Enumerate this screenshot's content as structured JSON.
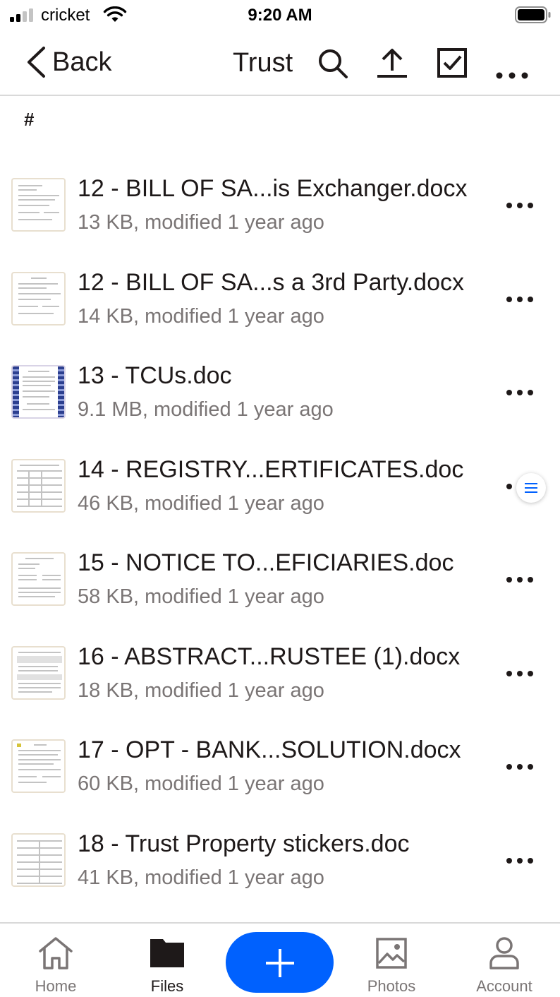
{
  "status_bar": {
    "carrier": "cricket",
    "time": "9:20 AM"
  },
  "nav": {
    "back_label": "Back",
    "title": "Trust"
  },
  "section_header": "#",
  "files": [
    {
      "name": "12 - BILL OF SA...is Exchanger.docx",
      "meta": "13 KB, modified 1 year ago",
      "thumb": "doc"
    },
    {
      "name": "12 - BILL OF SA...s a 3rd Party.docx",
      "meta": "14 KB, modified 1 year ago",
      "thumb": "doc"
    },
    {
      "name": "13 - TCUs.doc",
      "meta": "9.1 MB, modified 1 year ago",
      "thumb": "certificate"
    },
    {
      "name": "14 - REGISTRY...ERTIFICATES.doc",
      "meta": "46 KB, modified 1 year ago",
      "thumb": "table"
    },
    {
      "name": "15 - NOTICE TO...EFICIARIES.doc",
      "meta": "58 KB, modified 1 year ago",
      "thumb": "doc"
    },
    {
      "name": "16 - ABSTRACT...RUSTEE (1).docx",
      "meta": "18 KB, modified 1 year ago",
      "thumb": "form"
    },
    {
      "name": "17 - OPT - BANK...SOLUTION.docx",
      "meta": "60 KB, modified 1 year ago",
      "thumb": "doc"
    },
    {
      "name": "18 - Trust Property stickers.doc",
      "meta": "41 KB, modified 1 year ago",
      "thumb": "grid"
    }
  ],
  "tabs": [
    {
      "label": "Home",
      "icon": "home-icon",
      "active": false
    },
    {
      "label": "Files",
      "icon": "folder-icon",
      "active": true
    },
    {
      "label": "Photos",
      "icon": "photo-icon",
      "active": false
    },
    {
      "label": "Account",
      "icon": "person-icon",
      "active": false
    }
  ],
  "colors": {
    "accent": "#0061fe",
    "text": "#1e1919",
    "secondary_text": "#7a7575",
    "divider": "#d9d9d9"
  }
}
